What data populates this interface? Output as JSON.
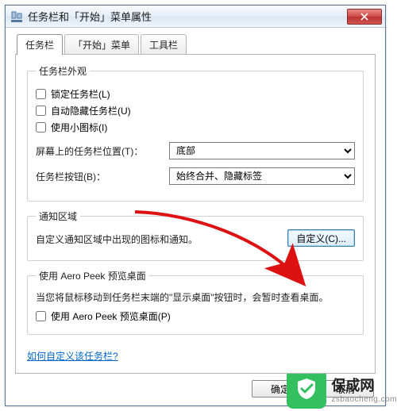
{
  "window": {
    "title": "任务栏和「开始」菜单属性"
  },
  "tabs": {
    "taskbar": "任务栏",
    "startmenu": "「开始」菜单",
    "toolbars": "工具栏"
  },
  "appearance": {
    "legend": "任务栏外观",
    "lock": "锁定任务栏(L)",
    "autohide": "自动隐藏任务栏(U)",
    "smallicons": "使用小图标(I)"
  },
  "position": {
    "label": "屏幕上的任务栏位置(T)：",
    "value": "底部"
  },
  "buttons": {
    "label": "任务栏按钮(B)：",
    "value": "始终合并、隐藏标签"
  },
  "notification": {
    "legend": "通知区域",
    "desc": "自定义通知区域中出现的图标和通知。",
    "customize": "自定义(C)..."
  },
  "aero": {
    "legend": "使用 Aero Peek 预览桌面",
    "desc": "当您将鼠标移动到任务栏末端的\"显示桌面\"按钮时，会暂时查看桌面。",
    "checkbox": "使用 Aero Peek 预览桌面(P)"
  },
  "help_link": "如何自定义该任务栏?",
  "dialog_buttons": {
    "ok": "确定",
    "cancel": "取消"
  },
  "watermark": {
    "cn": "保成网",
    "en": "zsbaocheng.com"
  }
}
